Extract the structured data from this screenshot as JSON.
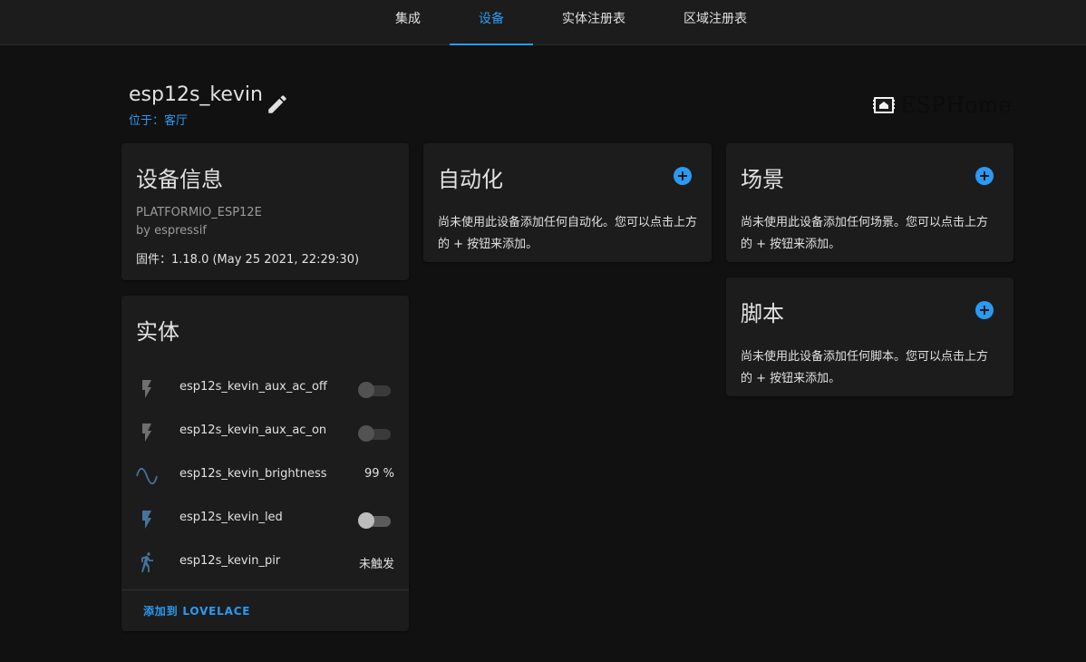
{
  "tabs": [
    {
      "label": "集成",
      "active": false
    },
    {
      "label": "设备",
      "active": true
    },
    {
      "label": "实体注册表",
      "active": false
    },
    {
      "label": "区域注册表",
      "active": false
    }
  ],
  "device": {
    "name": "esp12s_kevin",
    "location": "位于：客厅",
    "edit_icon": "pencil-icon"
  },
  "brand": {
    "name": "ESPHome",
    "icon": "esphome-logo-icon"
  },
  "device_info": {
    "title": "设备信息",
    "model": "PLATFORMIO_ESP12E",
    "manufacturer": "by espressif",
    "firmware": "固件：1.18.0 (May 25 2021, 22:29:30)"
  },
  "entities": {
    "title": "实体",
    "items": [
      {
        "name": "esp12s_kevin_aux_ac_off",
        "icon": "flash-icon",
        "control": "toggle",
        "state": "unavailable"
      },
      {
        "name": "esp12s_kevin_aux_ac_on",
        "icon": "flash-icon",
        "control": "toggle",
        "state": "unavailable"
      },
      {
        "name": "esp12s_kevin_brightness",
        "icon": "sine-wave-icon",
        "control": "value",
        "state": "99 %"
      },
      {
        "name": "esp12s_kevin_led",
        "icon": "flash-icon",
        "control": "toggle",
        "state": "off"
      },
      {
        "name": "esp12s_kevin_pir",
        "icon": "walk-icon",
        "control": "value",
        "state": "未触发"
      }
    ],
    "add_to_lovelace": "添加到 LOVELACE"
  },
  "automations": {
    "title": "自动化",
    "empty_text": "尚未使用此设备添加任何自动化。您可以点击上方的 + 按钮来添加。"
  },
  "scenes": {
    "title": "场景",
    "empty_text": "尚未使用此设备添加任何场景。您可以点击上方的 + 按钮来添加。"
  },
  "scripts": {
    "title": "脚本",
    "empty_text": "尚未使用此设备添加任何脚本。您可以点击上方的 + 按钮来添加。"
  },
  "colors": {
    "accent": "#2b9af3",
    "background": "#111111",
    "card": "#1c1c1c",
    "icon_disabled": "#6f6f6f",
    "icon_active": "#44739e"
  }
}
